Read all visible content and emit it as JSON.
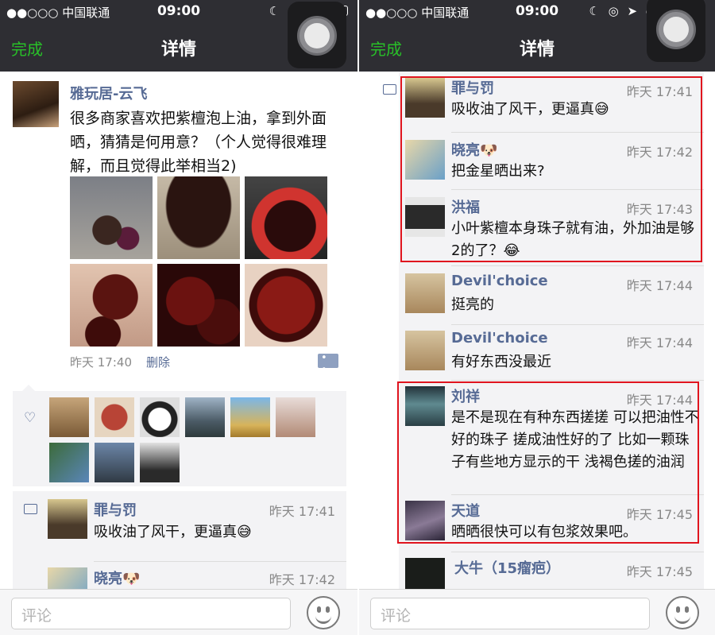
{
  "status": {
    "carrier": "●●○○○ 中国联通",
    "time": "09:00"
  },
  "nav": {
    "done_label": "完成",
    "title": "详情"
  },
  "post": {
    "author": "雅玩居-云飞",
    "text": "很多商家喜欢把紫檀泡上油，拿到外面晒，猜猜是何用意？（个人觉得很难理解，而且觉得此举相当2)",
    "time": "昨天 17:40",
    "delete_label": "删除"
  },
  "left_comments": [
    {
      "name": "罪与罚",
      "time": "昨天 17:41",
      "text": "吸收油了风干，更逼真😅"
    },
    {
      "name": "晓亮🐶",
      "time": "昨天 17:42",
      "text": ""
    }
  ],
  "right_comments": [
    {
      "name": "罪与罚",
      "time": "昨天 17:41",
      "text": "吸收油了风干，更逼真😅"
    },
    {
      "name": "晓亮🐶",
      "time": "昨天 17:42",
      "text": "把金星晒出来?"
    },
    {
      "name": "洪福",
      "time": "昨天 17:43",
      "text": "小叶紫檀本身珠子就有油，外加油是够2的了？😂"
    },
    {
      "name": "Devil'choice",
      "time": "昨天 17:44",
      "text": "挺亮的"
    },
    {
      "name": "Devil'choice",
      "time": "昨天 17:44",
      "text": "有好东西没最近"
    },
    {
      "name": "刘祥",
      "time": "昨天 17:44",
      "text": "是不是现在有种东西搓搓 可以把油性不好的珠子 搓成油性好的了 比如一颗珠子有些地方显示的干 浅褐色搓的油润"
    },
    {
      "name": "天道",
      "time": "昨天 17:45",
      "text": "晒晒很快可以有包浆效果吧。"
    },
    {
      "name": "大牛（15瘤疤）",
      "time": "昨天 17:45",
      "text": ""
    }
  ],
  "input": {
    "placeholder": "评论"
  },
  "colors": {
    "link": "#576b95",
    "highlight": "#e0141e",
    "done": "#28c028",
    "navbar": "#2e2e33"
  }
}
